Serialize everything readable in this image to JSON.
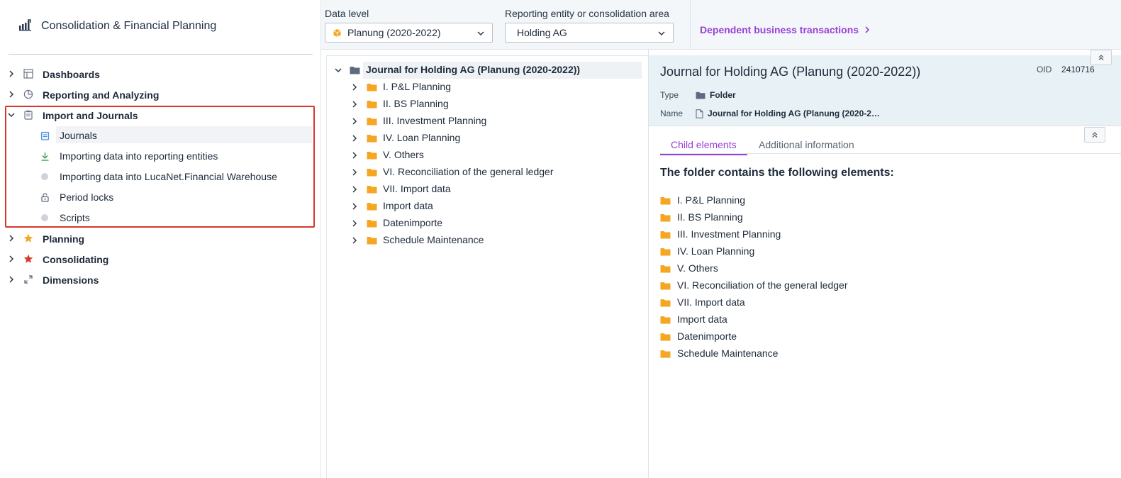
{
  "app": {
    "title": "Consolidation & Financial Planning"
  },
  "sidebar": {
    "items": [
      {
        "label": "Dashboards",
        "icon": "layout-icon",
        "expanded": false
      },
      {
        "label": "Reporting and Analyzing",
        "icon": "pie-chart-icon",
        "expanded": false
      },
      {
        "label": "Import and Journals",
        "icon": "clipboard-icon",
        "expanded": true,
        "children": [
          {
            "label": "Journals",
            "icon": "journal-icon",
            "active": true
          },
          {
            "label": "Importing data into reporting entities",
            "icon": "download-icon"
          },
          {
            "label": "Importing data into LucaNet.Financial Warehouse",
            "icon": "dot-icon"
          },
          {
            "label": "Period locks",
            "icon": "lock-icon"
          },
          {
            "label": "Scripts",
            "icon": "dot-icon"
          }
        ]
      },
      {
        "label": "Planning",
        "icon": "star-icon",
        "expanded": false
      },
      {
        "label": "Consolidating",
        "icon": "star-icon",
        "expanded": false
      },
      {
        "label": "Dimensions",
        "icon": "expand-arrows-icon",
        "expanded": false
      }
    ]
  },
  "toolbar": {
    "data_level_label": "Data level",
    "data_level_value": "Planung (2020-2022)",
    "entity_label": "Reporting entity or consolidation area",
    "entity_value": "Holding AG",
    "dependent_link": "Dependent business transactions"
  },
  "tree": {
    "root": "Journal for Holding AG (Planung (2020-2022))",
    "children": [
      "I. P&L Planning",
      "II. BS Planning",
      "III. Investment Planning",
      "IV. Loan Planning",
      "V. Others",
      "VI. Reconciliation of the general ledger",
      "VII. Import data",
      "Import data",
      "Datenimporte",
      "Schedule Maintenance"
    ]
  },
  "detail": {
    "title": "Journal for Holding AG (Planung (2020-2022))",
    "oid_label": "OID",
    "oid_value": "2410716",
    "type_label": "Type",
    "type_value": "Folder",
    "name_label": "Name",
    "name_value": "Journal for Holding AG (Planung (2020-2…",
    "tabs": [
      {
        "label": "Child elements",
        "active": true
      },
      {
        "label": "Additional information",
        "active": false
      }
    ],
    "section_title": "The folder contains the following elements:",
    "children": [
      "I. P&L Planning",
      "II. BS Planning",
      "III. Investment Planning",
      "IV. Loan Planning",
      "V. Others",
      "VI. Reconciliation of the general ledger",
      "VII. Import data",
      "Import data",
      "Datenimporte",
      "Schedule Maintenance"
    ]
  },
  "colors": {
    "accent": "#9a3fd8",
    "folder": "#f5a623",
    "highlight": "#d6382a",
    "header_bg": "#e8f1f5"
  }
}
